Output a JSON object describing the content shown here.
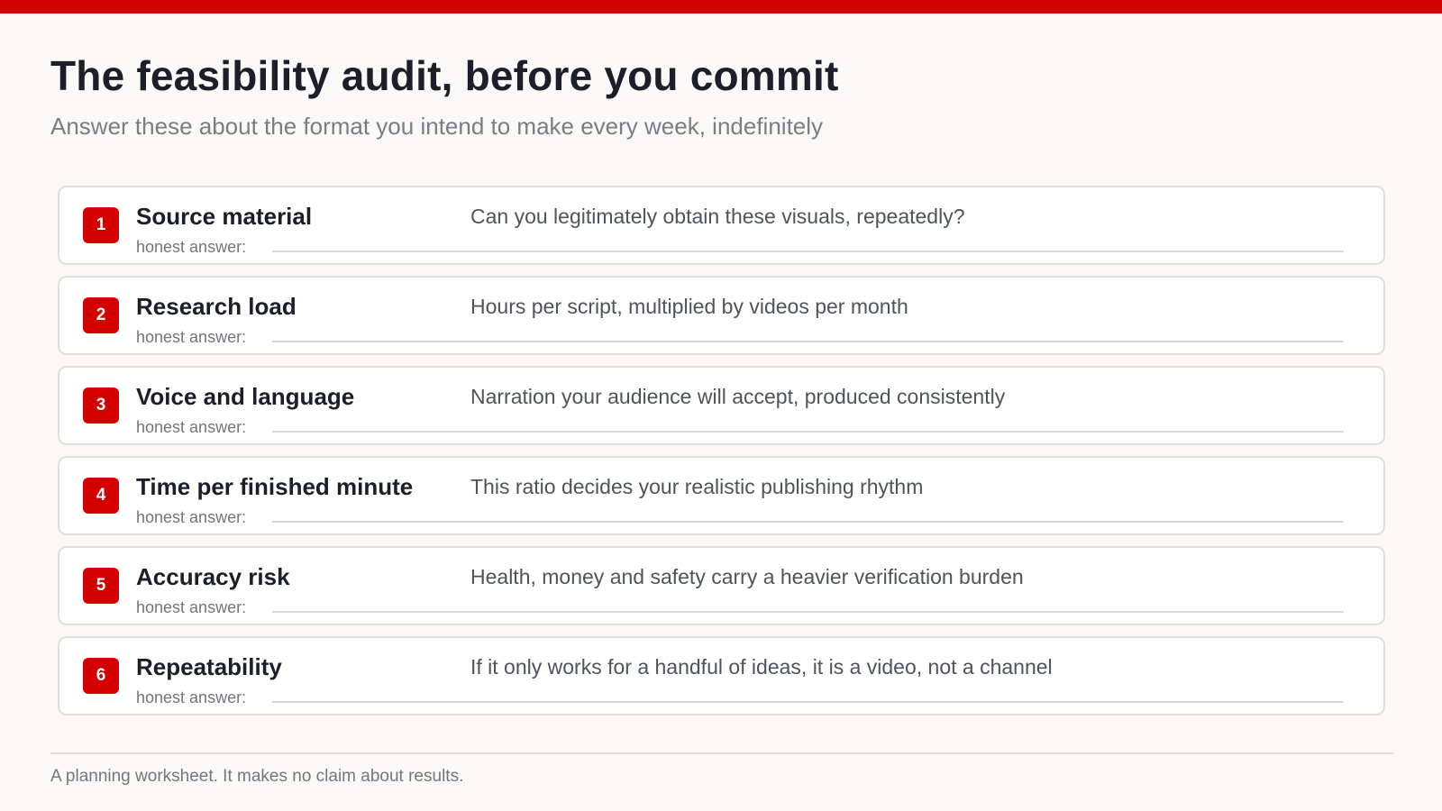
{
  "colors": {
    "accent": "#d40000",
    "background": "#faf9f7",
    "card_background": "#ffffff",
    "card_border": "#e1dfdb",
    "title_text": "#1c1f2a",
    "muted_text": "#7a7d85"
  },
  "header": {
    "title": "The feasibility audit, before you commit",
    "subtitle": "Answer these about the format you intend to make every week, indefinitely"
  },
  "audit": {
    "items": [
      {
        "number": "1",
        "label": "Source material",
        "description": "Can you legitimately obtain these visuals, repeatedly?",
        "answer_label": "honest answer:"
      },
      {
        "number": "2",
        "label": "Research load",
        "description": "Hours per script, multiplied by videos per month",
        "answer_label": "honest answer:"
      },
      {
        "number": "3",
        "label": "Voice and language",
        "description": "Narration your audience will accept, produced consistently",
        "answer_label": "honest answer:"
      },
      {
        "number": "4",
        "label": "Time per finished minute",
        "description": "This ratio decides your realistic publishing rhythm",
        "answer_label": "honest answer:"
      },
      {
        "number": "5",
        "label": "Accuracy risk",
        "description": "Health, money and safety carry a heavier verification burden",
        "answer_label": "honest answer:"
      },
      {
        "number": "6",
        "label": "Repeatability",
        "description": "If it only works for a handful of ideas, it is a video, not a channel",
        "answer_label": "honest answer:"
      }
    ]
  },
  "footer": {
    "note": "A planning worksheet. It makes no claim about results."
  }
}
